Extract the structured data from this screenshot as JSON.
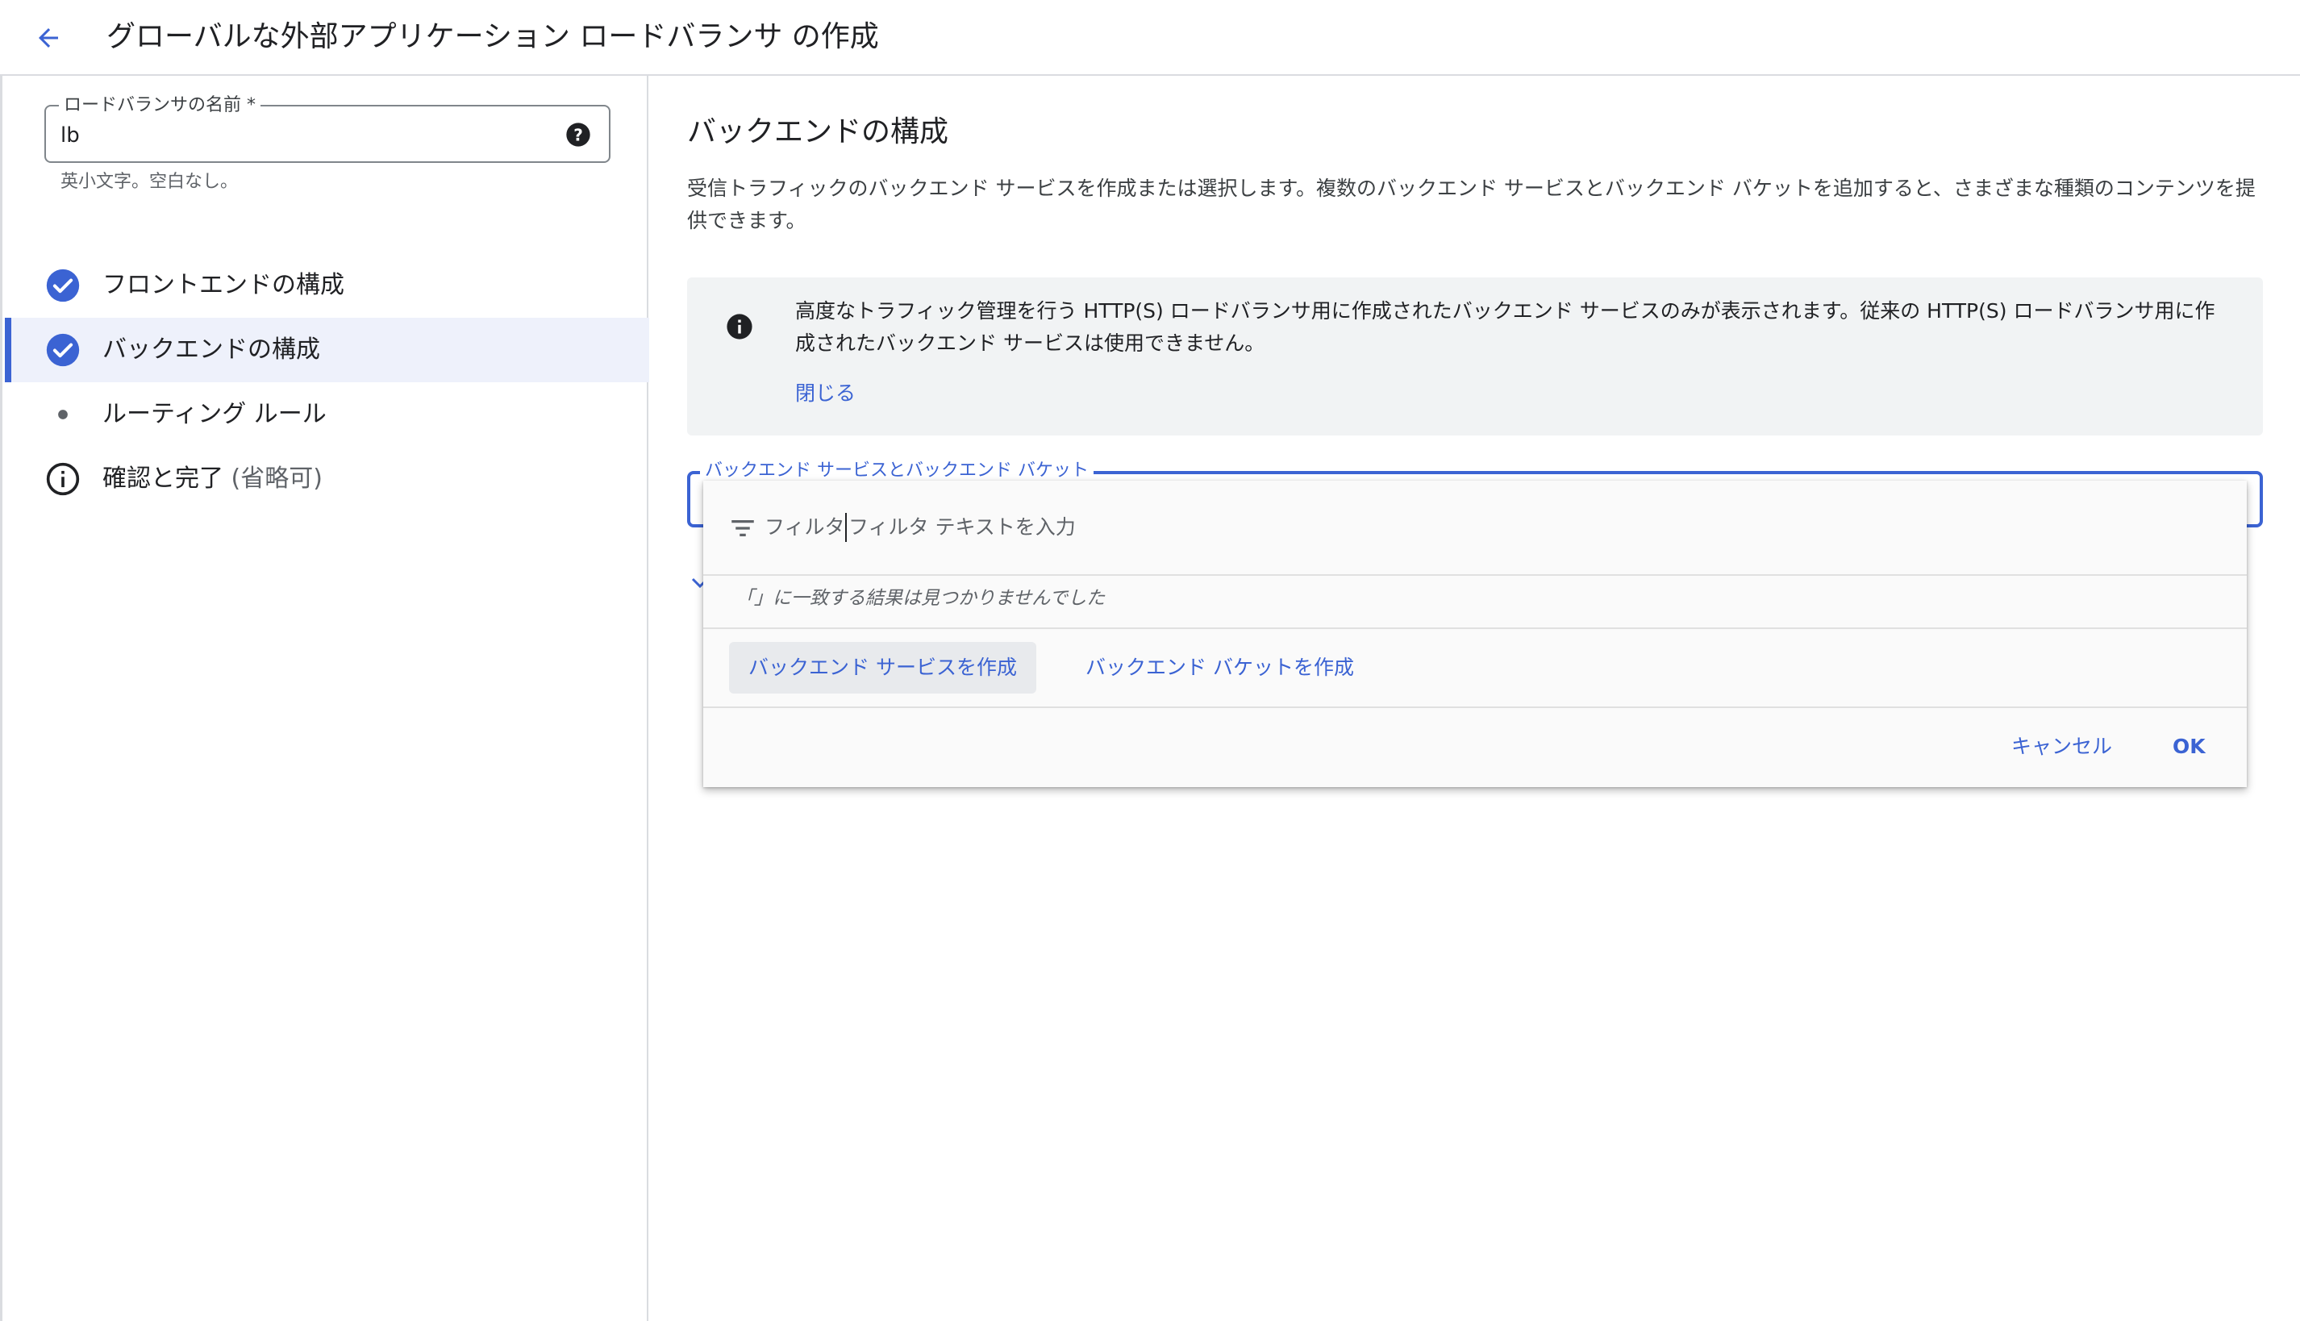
{
  "header": {
    "title": "グローバルな外部アプリケーション ロードバランサ の作成",
    "back_icon": "arrow-back-icon"
  },
  "sidebar": {
    "name_field": {
      "label": "ロードバランサの名前 *",
      "value": "lb",
      "hint": "英小文字。空白なし。"
    },
    "steps": [
      {
        "label": "フロントエンドの構成",
        "state": "completed",
        "icon": "check-circle-icon"
      },
      {
        "label": "バックエンドの構成",
        "state": "completed-active",
        "icon": "check-circle-icon"
      },
      {
        "label": "ルーティング ルール",
        "state": "pending",
        "icon": "dot-icon"
      },
      {
        "label": "確認と完了",
        "optional": "(省略可)",
        "state": "info",
        "icon": "info-icon"
      }
    ]
  },
  "main": {
    "title": "バックエンドの構成",
    "description": "受信トラフィックのバックエンド サービスを作成または選択します。複数のバックエンド サービスとバックエンド バケットを追加すると、さまざまな種類のコンテンツを提供できます。",
    "info_box": {
      "text": "高度なトラフィック管理を行う HTTP(S) ロードバランサ用に作成されたバックエンド サービスのみが表示されます。従来の HTTP(S) ロードバランサ用に作成されたバックエンド サービスは使用できません。",
      "close_label": "閉じる"
    },
    "backend_field": {
      "label": "バックエンド サービスとバックエンド バケット"
    }
  },
  "dropdown": {
    "filter_label": "フィルタ",
    "filter_placeholder": "フィルタ テキストを入力",
    "filter_value": "",
    "no_results": "「」に一致する結果は見つかりませんでした",
    "create_service_label": "バックエンド サービスを作成",
    "create_bucket_label": "バックエンド バケットを作成",
    "cancel_label": "キャンセル",
    "ok_label": "OK"
  },
  "colors": {
    "accent": "#3b63d3",
    "active_bg": "#eef1fb",
    "info_bg": "#f1f3f4",
    "text_primary": "#202124",
    "text_secondary": "#5f6368"
  }
}
